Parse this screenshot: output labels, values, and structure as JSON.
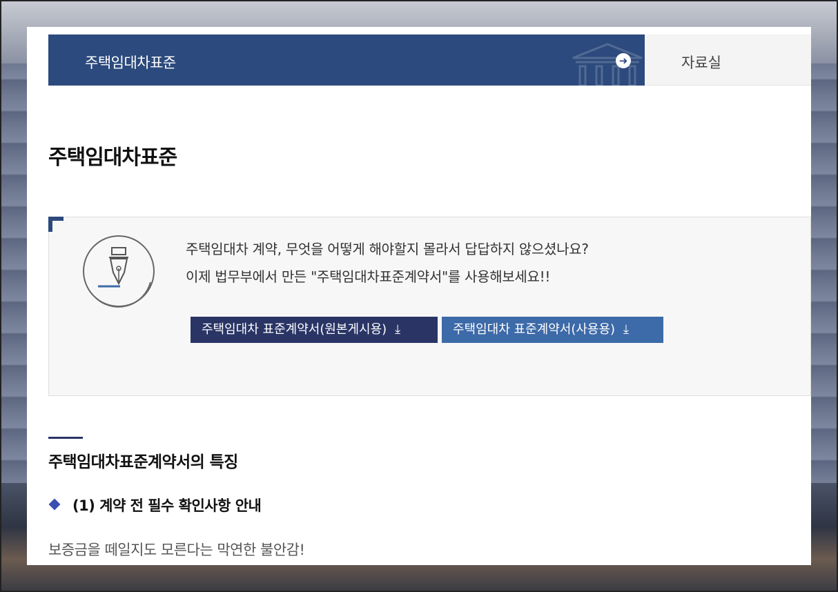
{
  "nav": {
    "current_label": "주택임대차표준",
    "next_label": "자료실"
  },
  "page": {
    "title": "주택임대차표준"
  },
  "intro": {
    "line1": "주택임대차 계약, 무엇을 어떻게 해야할지 몰라서 답답하지 않으셨나요?",
    "line2": "이제 법무부에서 만든 \"주택임대차표준계약서\"를 사용해보세요!!",
    "buttons": [
      {
        "label": "주택임대차 표준계약서(원본게시용)",
        "icon": "download-icon"
      },
      {
        "label": "주택임대차 표준계약서(사용용)",
        "icon": "download-icon"
      }
    ]
  },
  "features": {
    "title": "주택임대차표준계약서의 특징",
    "item1_title": "(1) 계약 전 필수 확인사항 안내",
    "item1_text": "보증금을 떼일지도 모른다는 막연한 불안감!"
  },
  "colors": {
    "nav_active_bg": "#2c4a7d",
    "btn_original_bg": "#2a3566",
    "btn_use_bg": "#3d6aa8",
    "diamond": "#3b4fb0"
  }
}
